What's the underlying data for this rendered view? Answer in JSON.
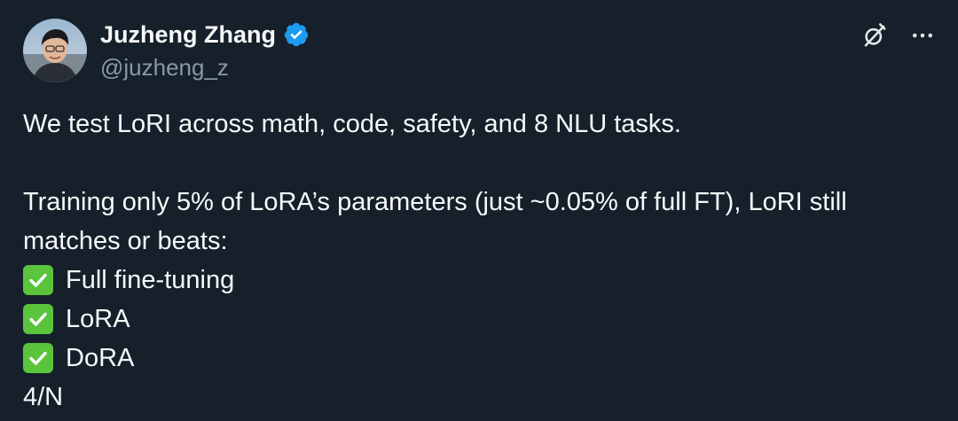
{
  "author": {
    "display_name": "Juzheng Zhang",
    "handle": "@juzheng_z",
    "verified_icon": "verified-badge-icon",
    "verified_color": "#1d9bf0"
  },
  "actions": {
    "grok_icon": "grok-icon",
    "more_icon": "more-icon"
  },
  "tweet": {
    "line1": "We test LoRI across math, code, safety, and 8 NLU tasks.",
    "line2": "Training only 5% of LoRA’s parameters (just ~0.05% of full FT), LoRI still matches or beats:",
    "checks": [
      {
        "icon": "check-mark-button-icon",
        "label": "Full fine-tuning"
      },
      {
        "icon": "check-mark-button-icon",
        "label": "LoRA"
      },
      {
        "icon": "check-mark-button-icon",
        "label": "DoRA"
      }
    ],
    "footer": "4/N"
  },
  "colors": {
    "background": "#15202b",
    "text": "#f7f9f9",
    "muted": "#8b98a5",
    "check_green": "#5ac43c"
  }
}
